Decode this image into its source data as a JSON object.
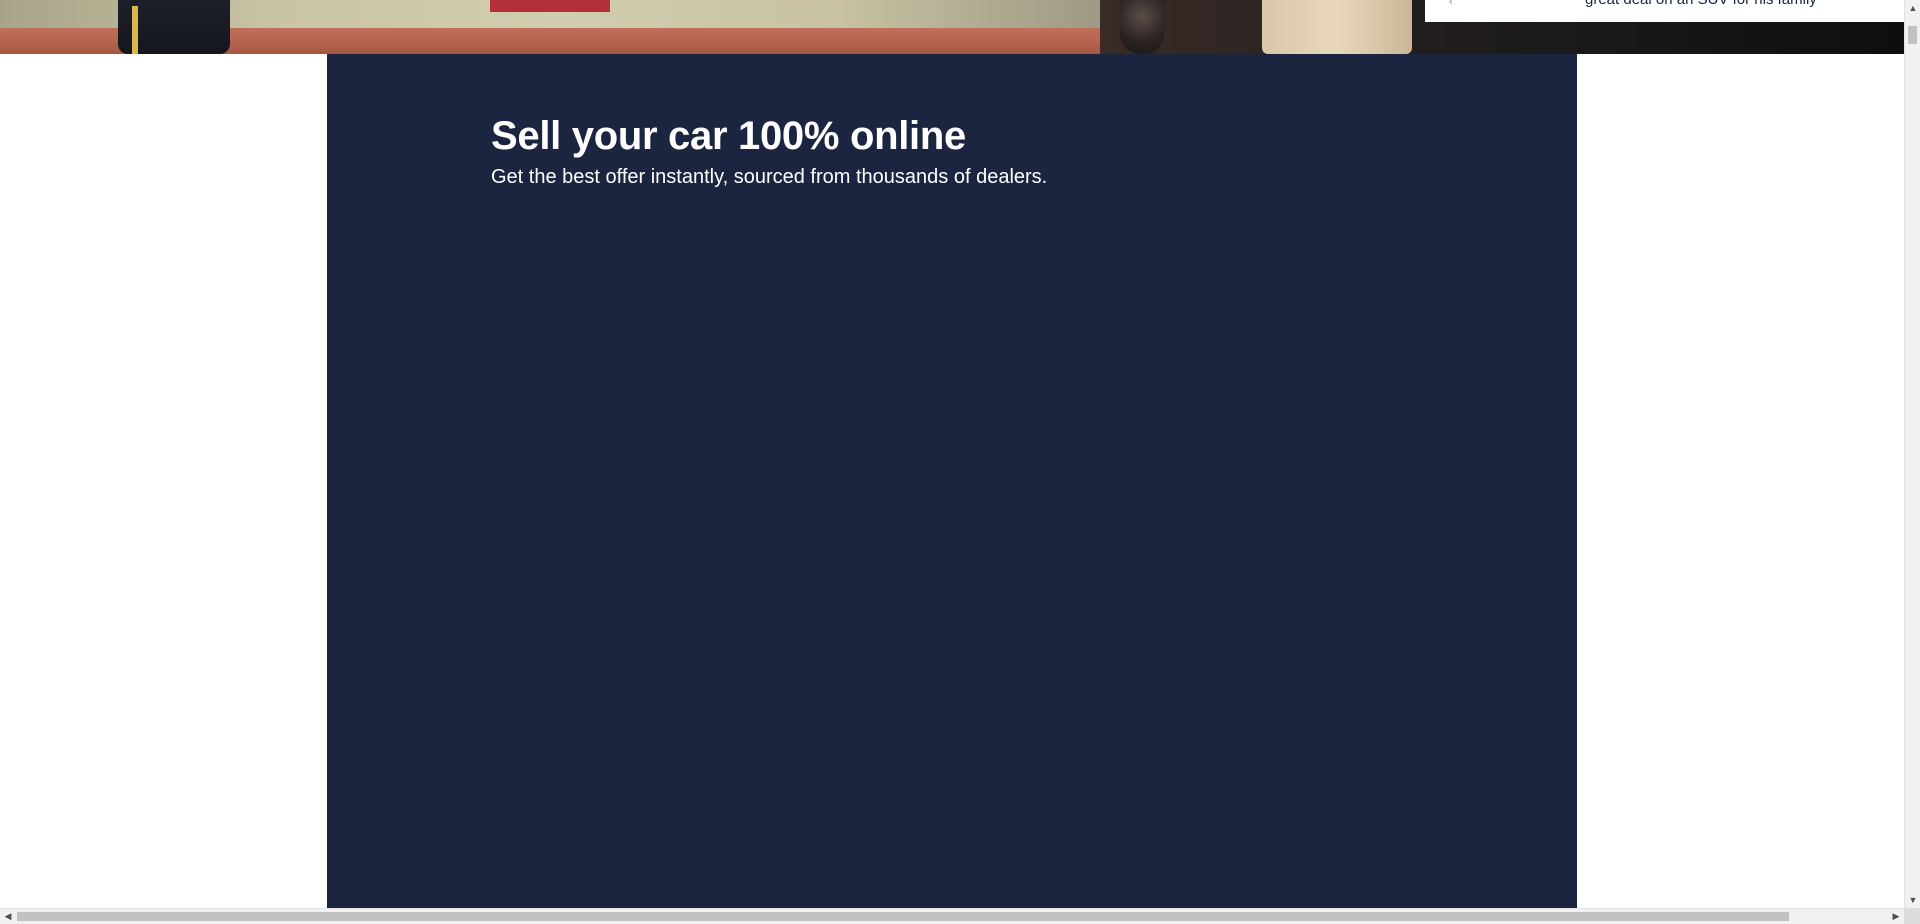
{
  "hero": {
    "image_label": "hero-photo"
  },
  "testimonial": {
    "quote_partial": "great deal on an SUV for his family"
  },
  "sell_section": {
    "title": "Sell your car 100% online",
    "subtitle": "Get the best offer instantly, sourced from thousands of dealers."
  },
  "colors": {
    "panel_background": "#1b2540",
    "title_text": "#ffffff",
    "page_background": "#ffffff"
  },
  "scrollbars": {
    "up_arrow": "▲",
    "down_arrow": "▼",
    "left_arrow": "◀",
    "right_arrow": "▶"
  }
}
